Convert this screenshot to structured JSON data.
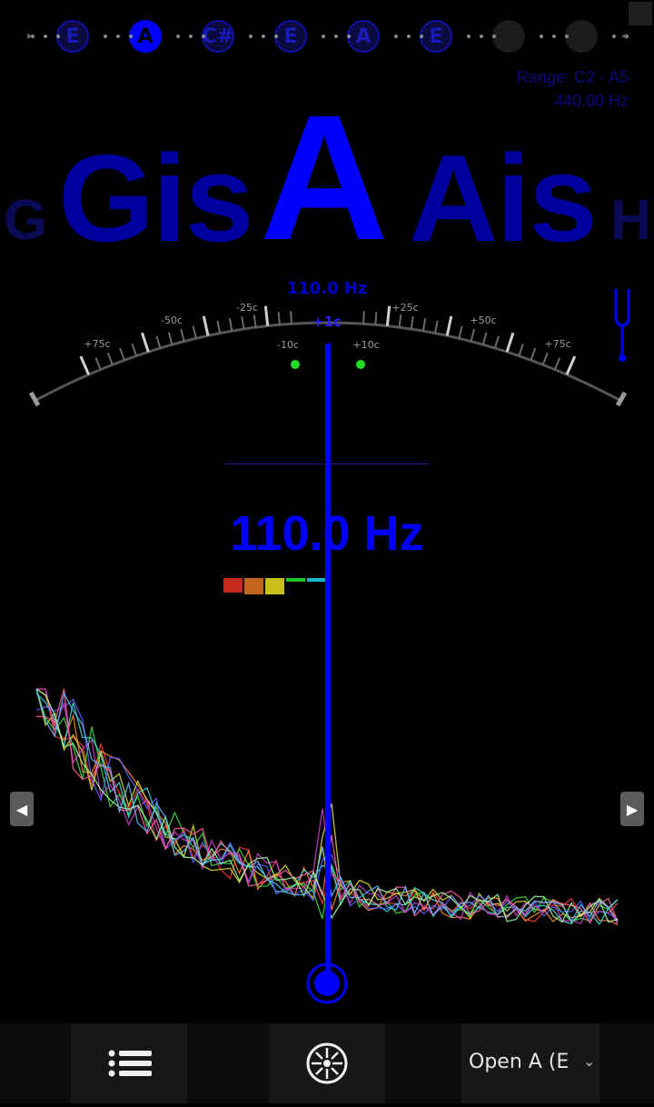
{
  "strings": [
    {
      "label": "E",
      "state": "dim"
    },
    {
      "label": "A",
      "state": "active"
    },
    {
      "label": "C#",
      "state": "dim"
    },
    {
      "label": "E",
      "state": "dim"
    },
    {
      "label": "A",
      "state": "dim"
    },
    {
      "label": "E",
      "state": "dim"
    },
    {
      "label": "",
      "state": "empty"
    },
    {
      "label": "",
      "state": "empty"
    }
  ],
  "range_text": "Range: C2 - A5",
  "reference_text": "440.00 Hz",
  "notes": {
    "far_left": "G",
    "left": "Gis",
    "current": "A",
    "right": "Ais",
    "far_right": "H"
  },
  "meter": {
    "freq_label": "110.0 Hz",
    "cents_label": "+1c",
    "ticks": {
      "left": [
        "+75c",
        "-50c",
        "-25c",
        "-10c"
      ],
      "right": [
        "+10c",
        "+25c",
        "+50c",
        "+75c"
      ]
    },
    "cents_offset": 1
  },
  "frequency_display": "110.0 Hz",
  "level_bars": [
    "#c62a1a",
    "#c2651a",
    "#c8bf1a",
    "#1ac428",
    "#1ab7c8"
  ],
  "bottom_bar": {
    "tuning_label": "Open A (E",
    "tuning_caret": "⌄"
  },
  "icons": {
    "menu": "list-icon",
    "wheel": "tuning-wheel-icon",
    "tuning_fork": "tuning-fork-icon",
    "left_arrow": "arrow-left-icon",
    "right_arrow": "arrow-right-icon"
  },
  "colors": {
    "accent": "#0000ff",
    "dim_note": "#0000a0",
    "in_tune_dot": "#22dd22"
  },
  "arrows": {
    "left": "◀",
    "right": "▶"
  }
}
